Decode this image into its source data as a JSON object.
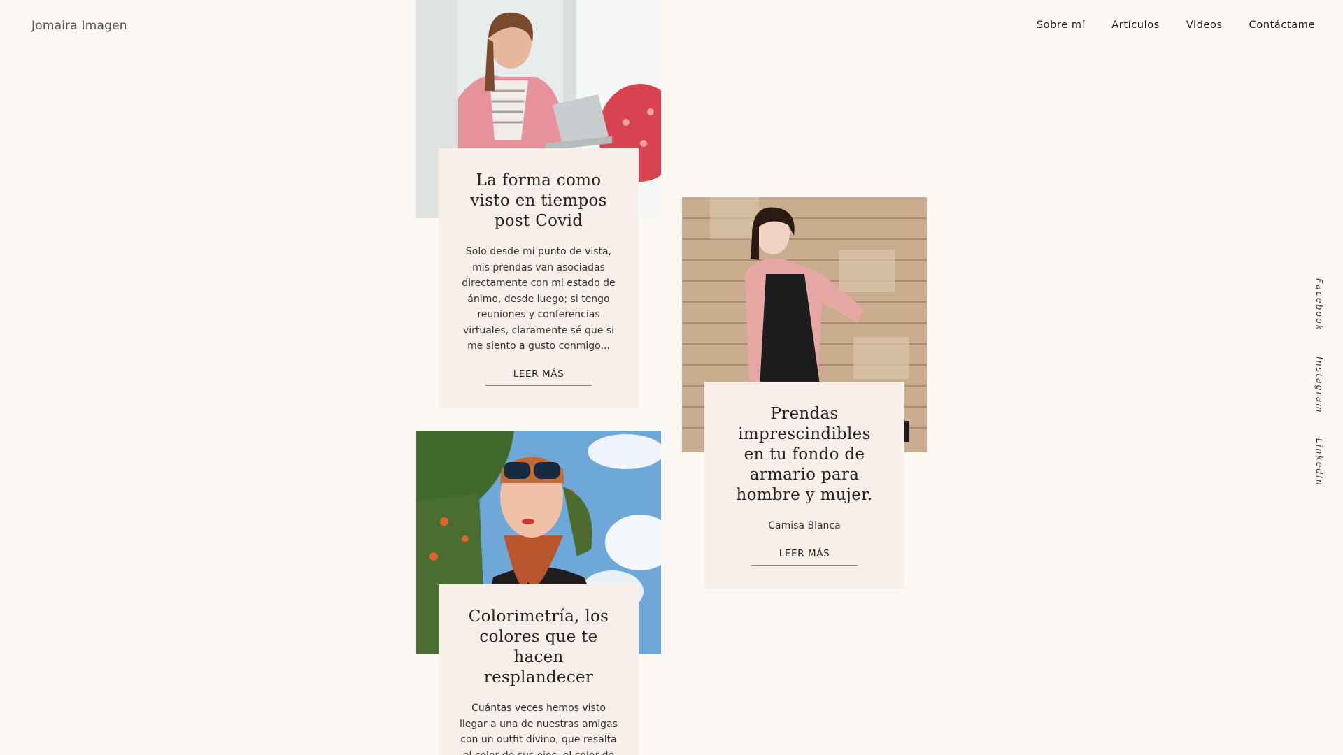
{
  "header": {
    "logo": "Jomaira Imagen",
    "nav": [
      "Sobre mí",
      "Artículos",
      "Videos",
      "Contáctame"
    ]
  },
  "social": [
    "Facebook",
    "Instagram",
    "LinkedIn"
  ],
  "articles": [
    {
      "title": "La forma como visto en tiempos post Covid",
      "excerpt": "Solo desde mi punto de vista, mis prendas van asociadas directamente con mi estado de ánimo, desde luego; si tengo reuniones y conferencias virtuales, claramente sé que si me siento a gusto conmigo...",
      "cta": "LEER MÁS"
    },
    {
      "title": "Prendas imprescindibles en tu fondo de armario para hombre y mujer.",
      "excerpt": "Camisa Blanca",
      "cta": "LEER MÁS"
    },
    {
      "title": "Colorimetría, los colores que te hacen resplandecer",
      "excerpt": "Cuántas veces hemos visto llegar a una de nuestras amigas con un outfit divino, que resalta el color de sus ojos, el color de su piel y"
    }
  ]
}
